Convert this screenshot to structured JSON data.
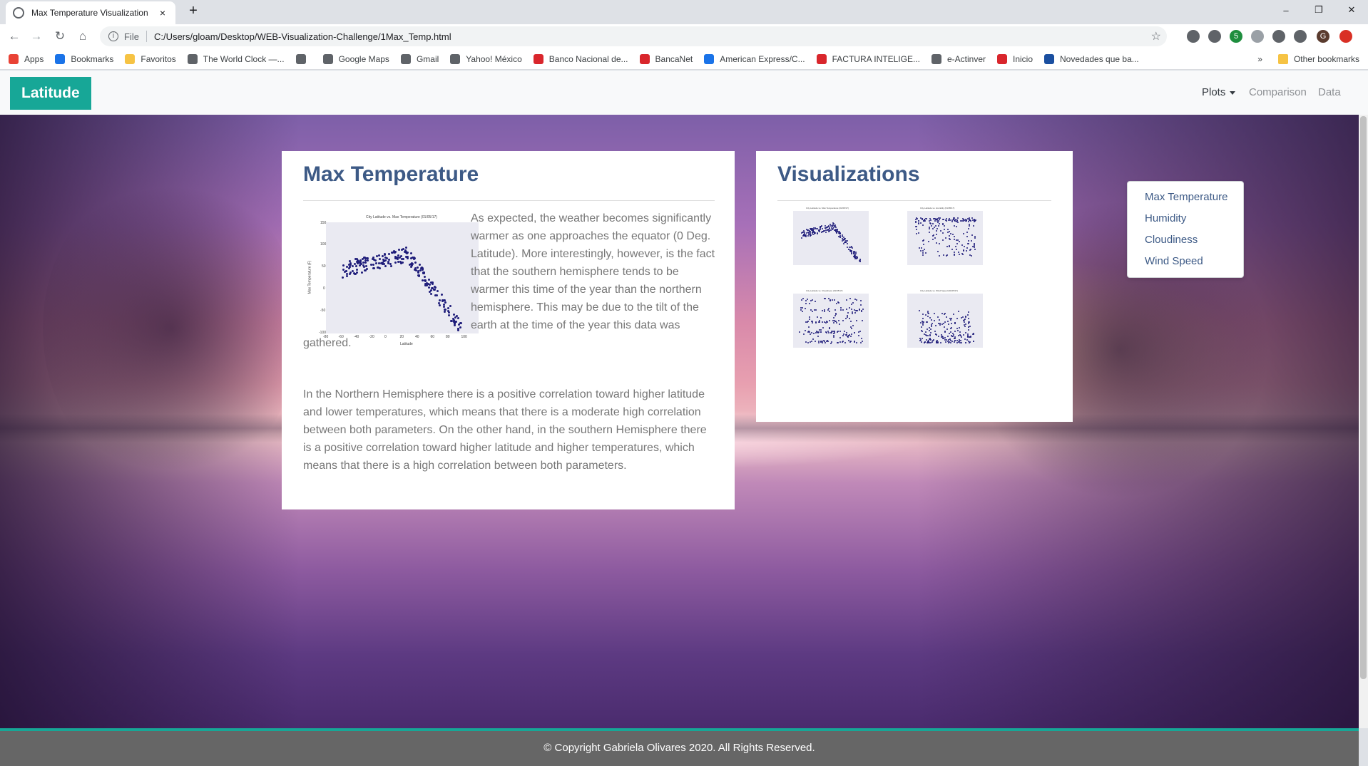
{
  "browser": {
    "tab_title": "Max Temperature Visualization",
    "tab_close": "×",
    "new_tab": "+",
    "url_scheme": "File",
    "url": "C:/Users/gloam/Desktop/WEB-Visualization-Challenge/1Max_Temp.html",
    "window_controls": [
      "–",
      "❐",
      "✕"
    ],
    "extension_badge": "5",
    "profile_initial": "G",
    "bookmarks": [
      {
        "label": "Apps",
        "color": "#e94235"
      },
      {
        "label": "Bookmarks",
        "color": "#1a73e8"
      },
      {
        "label": "Favoritos",
        "color": "#f6c344"
      },
      {
        "label": "The World Clock —...",
        "color": "#5f6368"
      },
      {
        "label": "",
        "color": "#5f6368"
      },
      {
        "label": "Google Maps",
        "color": "#5f6368"
      },
      {
        "label": "Gmail",
        "color": "#5f6368"
      },
      {
        "label": "Yahoo! México",
        "color": "#5f6368"
      },
      {
        "label": "Banco Nacional de...",
        "color": "#d9262c"
      },
      {
        "label": "BancaNet",
        "color": "#d9262c"
      },
      {
        "label": "American Express/C...",
        "color": "#1a73e8"
      },
      {
        "label": "FACTURA INTELIGE...",
        "color": "#d9262c"
      },
      {
        "label": "e-Actinver",
        "color": "#5f6368"
      },
      {
        "label": "Inicio",
        "color": "#d9262c"
      },
      {
        "label": "Novedades que ba...",
        "color": "#1a4fa0"
      }
    ],
    "bookmarks_more": "»",
    "other_bookmarks": "Other bookmarks"
  },
  "nav": {
    "brand": "Latitude",
    "plots": "Plots",
    "comparison": "Comparison",
    "data": "Data",
    "dropdown": [
      "Max Temperature",
      "Humidity",
      "Cloudiness",
      "Wind Speed"
    ]
  },
  "main_card": {
    "title": "Max Temperature",
    "paragraph1": "As expected, the weather becomes significantly warmer as one approaches the equator (0 Deg. Latitude). More interestingly, however, is the fact that the southern hemisphere tends to be warmer this time of the year than the northern hemisphere. This may be due to the tilt of the earth at the time of the year this data was gathered.",
    "paragraph2": "In the Northern Hemisphere there is a positive correlation toward higher latitude and lower temperatures, which means that there is a moderate high correlation between both parameters. On the other hand, in the southern Hemisphere there is a positive correlation toward higher latitude and higher temperatures, which means that there is a high correlation between both parameters.",
    "plot": {
      "title": "City Latitude vs. Max Temperature (01/05/17)",
      "xlabel": "Latitude",
      "ylabel": "Max Temperature (F)",
      "yticks": [
        "150",
        "100",
        "50",
        "0",
        "-50",
        "-100"
      ],
      "xticks": [
        "-80",
        "-60",
        "-40",
        "-20",
        "0",
        "20",
        "40",
        "60",
        "80",
        "100"
      ]
    }
  },
  "viz_card": {
    "title": "Visualizations",
    "thumbs": [
      {
        "title": "City Latitude vs. Max Temperature (01/05/17)",
        "kind": "temp"
      },
      {
        "title": "City Latitude vs. Humidity (01/05/17)",
        "kind": "humidity"
      },
      {
        "title": "City Latitude vs. Cloudiness (01/05/17)",
        "kind": "cloud"
      },
      {
        "title": "City Latitude vs. Wind Speed (01/05/17)",
        "kind": "wind"
      }
    ]
  },
  "footer": {
    "text": "© Copyright Gabriela Olivares 2020. All Rights Reserved."
  },
  "colors": {
    "accent": "#17a797",
    "heading": "#3d5a86",
    "marker": "#1f1d7a"
  }
}
